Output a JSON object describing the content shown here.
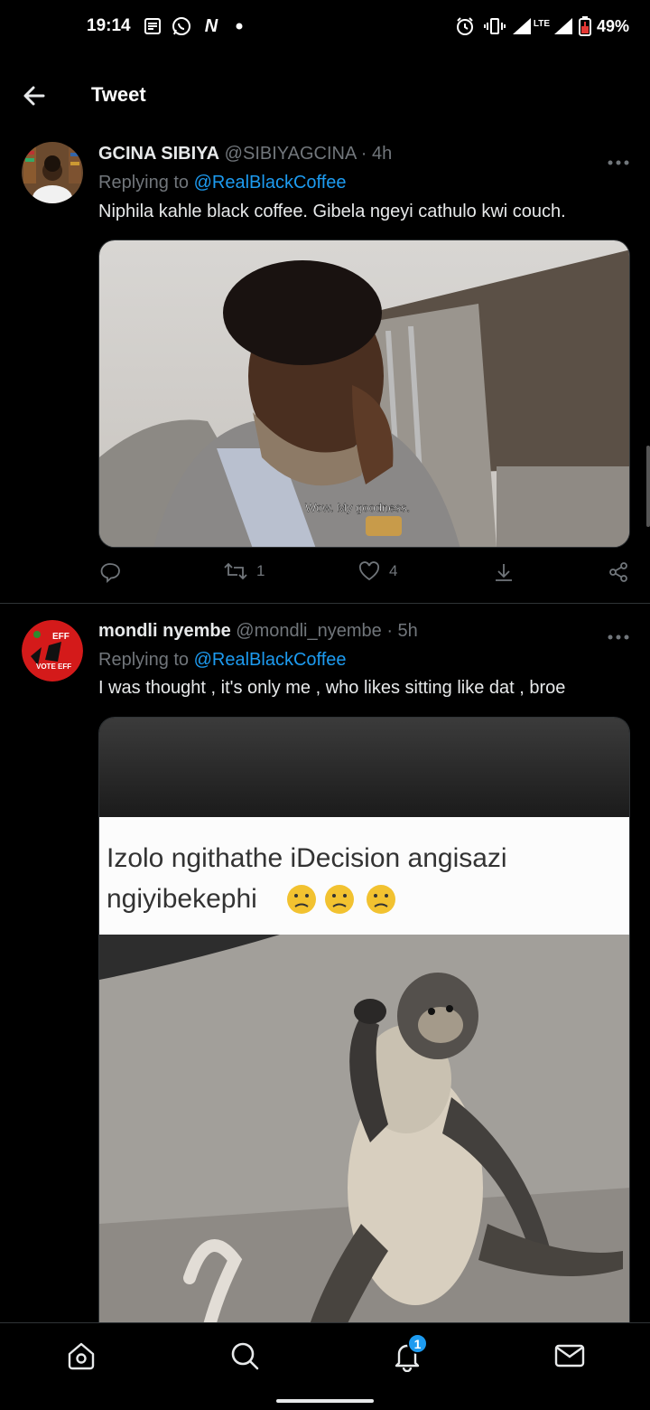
{
  "status_bar": {
    "time": "19:14",
    "network": "LTE",
    "battery": "49%",
    "icons": [
      "news-icon",
      "whatsapp-icon",
      "n-app-icon",
      "dot-icon",
      "alarm-icon",
      "vibrate-icon",
      "signal-icon",
      "signal-icon",
      "battery-icon"
    ]
  },
  "header": {
    "title": "Tweet"
  },
  "tweets": [
    {
      "name": "GCINA SIBIYA",
      "handle": "@SIBIYAGCINA",
      "time": "· 4h",
      "replying_prefix": "Replying to",
      "replying_to": "@RealBlackCoffee",
      "text": "Niphila kahle black coffee. Gibela ngeyi cathulo kwi couch.",
      "media_caption": "Wow. My goodness.",
      "retweets": "1",
      "likes": "4"
    },
    {
      "name": "mondli nyembe",
      "handle": "@mondli_nyembe",
      "time": "· 5h",
      "replying_prefix": "Replying to",
      "replying_to": "@RealBlackCoffee",
      "text": "I was thought , it's only me , who likes sitting like dat , broe",
      "media_text_line1": "Izolo ngithathe iDecision angisazi",
      "media_text_line2": "ngiyibekephi",
      "avatar_text_1": "EFF",
      "avatar_text_2": "VOTE EFF"
    }
  ],
  "bottom_nav": {
    "items": [
      "home-icon",
      "search-icon",
      "notifications-icon",
      "messages-icon"
    ],
    "notification_badge": "1"
  },
  "colors": {
    "accent": "#1d9bf0",
    "secondary_text": "#71767b",
    "divider": "#2f3336"
  }
}
